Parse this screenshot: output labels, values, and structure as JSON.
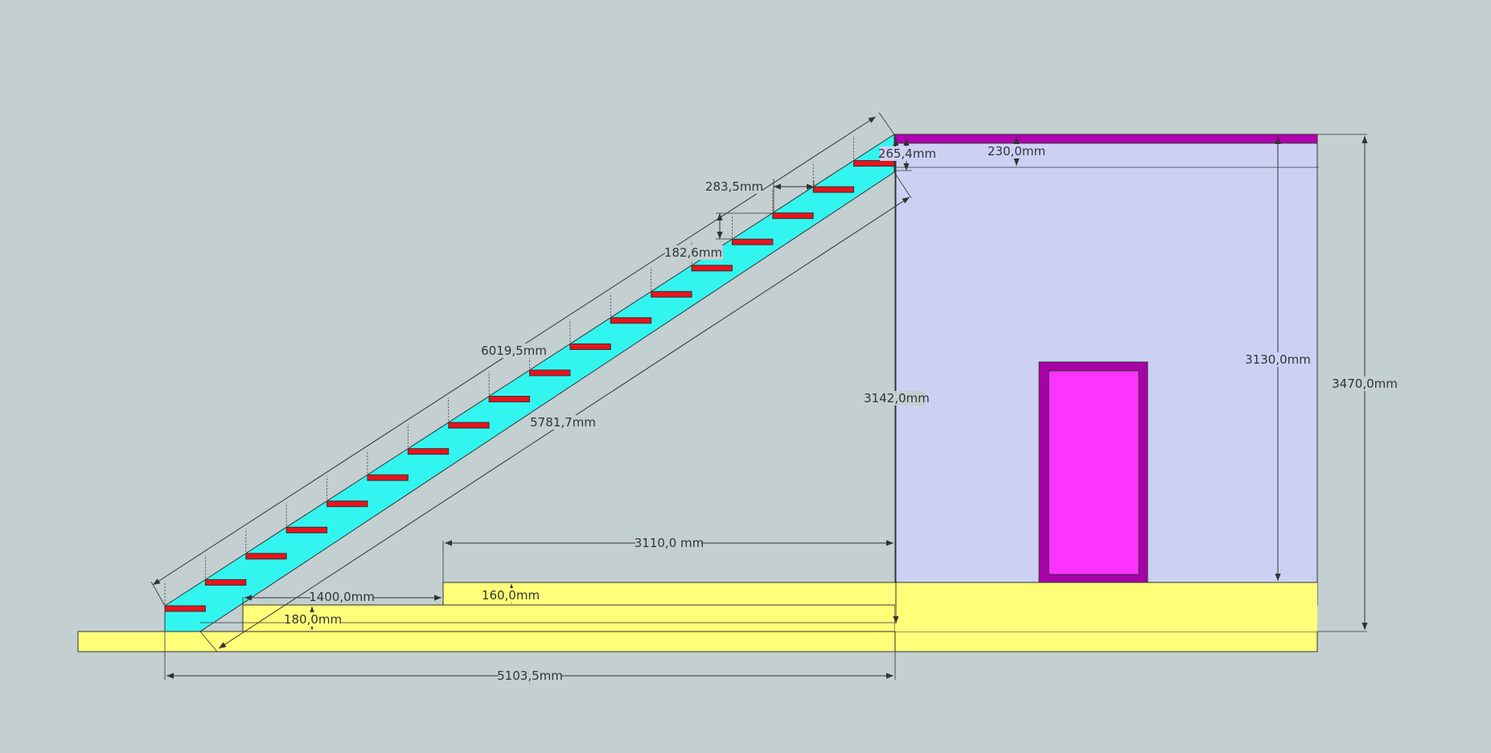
{
  "colors": {
    "background": "#c3cfd0",
    "ground": "#ffff7a",
    "stringer": "#33f5f0",
    "tread": "#e8141c",
    "wall": "#ccd1f4",
    "slab": "#b000b0",
    "door_frame": "#a800a8",
    "door_panel": "#ff33ff",
    "line": "#333333"
  },
  "dimensions": {
    "stringer_top_length": "6019,5mm",
    "stringer_bottom_length": "5781,7mm",
    "tread_depth": "283,5mm",
    "step_rise": "182,6mm",
    "top_offset": "265,4mm",
    "slab_thickness": "230,0mm",
    "stair_height": "3142,0mm",
    "wall_height": "3130,0mm",
    "total_height": "3470,0mm",
    "upper_floor_length": "3110,0 mm",
    "first_step_length": "1400,0mm",
    "upper_step_height": "160,0mm",
    "lower_step_height": "180,0mm",
    "total_run": "5103,5mm"
  },
  "stair": {
    "tread_count": 18
  }
}
